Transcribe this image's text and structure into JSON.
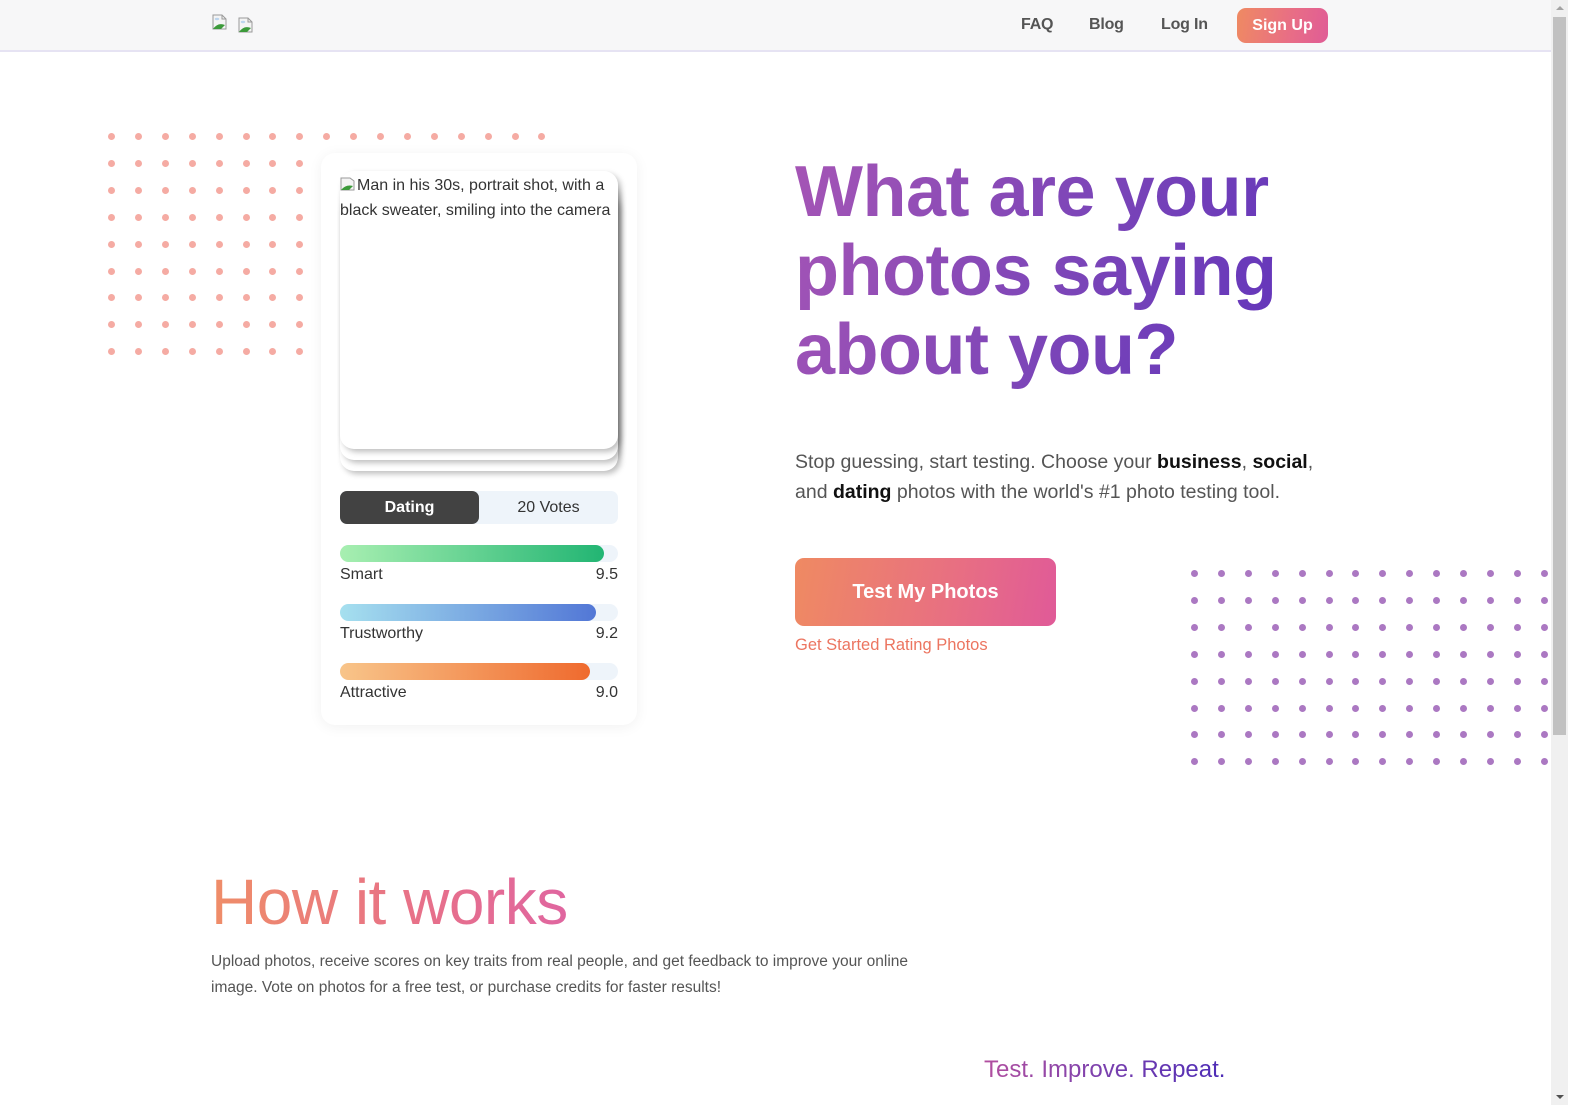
{
  "navbar": {
    "logo_images": [
      "broken-image-icon",
      "broken-image-icon"
    ],
    "links": [
      {
        "label": "FAQ"
      },
      {
        "label": "Blog"
      },
      {
        "label": "Log In"
      }
    ],
    "signup_label": "Sign Up"
  },
  "card": {
    "photo_alt": "Man in his 30s, portrait shot, with a black sweater, smiling into the camera",
    "category_label": "Dating",
    "votes_label": "20 Votes",
    "metrics": [
      {
        "label": "Smart",
        "value": "9.5",
        "fill_fraction": 0.95,
        "gradient": [
          "#a8efb1",
          "#22b573"
        ]
      },
      {
        "label": "Trustworthy",
        "value": "9.2",
        "fill_fraction": 0.92,
        "gradient": [
          "#a6e0ef",
          "#5277d6"
        ]
      },
      {
        "label": "Attractive",
        "value": "9.0",
        "fill_fraction": 0.9,
        "gradient": [
          "#f8c58a",
          "#ef6a2e"
        ]
      }
    ]
  },
  "hero": {
    "title": "What are your photos saying about you?",
    "subtitle_parts": {
      "p1": "Stop guessing, start testing. Choose your ",
      "b1": "business",
      "p2": ", ",
      "b2": "social",
      "p3": ", and ",
      "b3": "dating",
      "p4": " photos with the world's #1 photo testing tool."
    },
    "cta_label": "Test My Photos",
    "cta_link": "Get Started Rating Photos"
  },
  "how_it_works": {
    "title": "How it works",
    "description": "Upload photos, receive scores on key traits from real people, and get feedback to improve your online image. Vote on photos for a free test, or purchase credits for faster results!",
    "tagline": "Test. Improve. Repeat."
  },
  "colors": {
    "accent_orange": "#ef8a62",
    "accent_pink": "#e05c96",
    "accent_purple": "#5a30bb",
    "dot_pink": "#f5aba3",
    "dot_purple": "#ab78c2",
    "link_orange": "#ec7560"
  }
}
